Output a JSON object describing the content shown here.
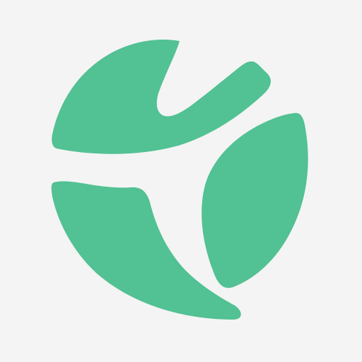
{
  "logo": {
    "icon": "leaf-globe-logo-icon",
    "colors": {
      "background": "#f4f4f4",
      "mark": "#52c193"
    }
  }
}
